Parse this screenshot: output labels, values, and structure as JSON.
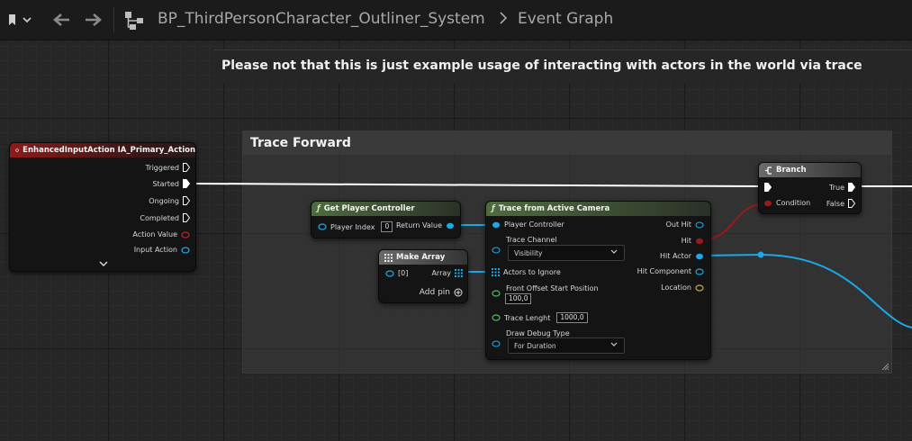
{
  "toolbar": {
    "breadcrumb_path": "BP_ThirdPersonCharacter_Outliner_System",
    "current_graph": "Event Graph"
  },
  "comments": {
    "top_note": "Please not that this is just example usage of interacting with actors in the world via trace",
    "trace_group_title": "Trace Forward"
  },
  "nodes": {
    "event": {
      "title": "EnhancedInputAction IA_Primary_Action",
      "pins": {
        "triggered": "Triggered",
        "started": "Started",
        "ongoing": "Ongoing",
        "completed": "Completed",
        "action_value": "Action Value",
        "input_action": "Input Action"
      }
    },
    "get_player_controller": {
      "title": "Get Player Controller",
      "player_index_label": "Player Index",
      "player_index_value": "0",
      "return_value_label": "Return Value"
    },
    "make_array": {
      "title": "Make Array",
      "element_label": "[0]",
      "array_label": "Array",
      "add_pin_label": "Add pin"
    },
    "trace": {
      "title": "Trace from Active Camera",
      "player_controller": "Player Controller",
      "trace_channel": "Trace Channel",
      "trace_channel_value": "Visibility",
      "actors_to_ignore": "Actors to Ignore",
      "front_offset": "Front Offset Start Position",
      "front_offset_value": "100,0",
      "trace_length": "Trace Lenght",
      "trace_length_value": "1000,0",
      "draw_debug": "Draw Debug Type",
      "draw_debug_value": "For Duration",
      "out_hit": "Out Hit",
      "hit": "Hit",
      "hit_actor": "Hit Actor",
      "hit_component": "Hit Component",
      "location": "Location"
    },
    "branch": {
      "title": "Branch",
      "condition": "Condition",
      "true_label": "True",
      "false_label": "False"
    }
  },
  "colors": {
    "exec": "#ffffff",
    "object": "#1aa8e8",
    "boolean": "#9a1a1a",
    "struct": "#6a8a4a",
    "vector": "#c8b040",
    "float_green": "#58b858",
    "action_value": "#c02020",
    "event_header": "#8e1a1a",
    "function_header": "#4f6b40"
  }
}
